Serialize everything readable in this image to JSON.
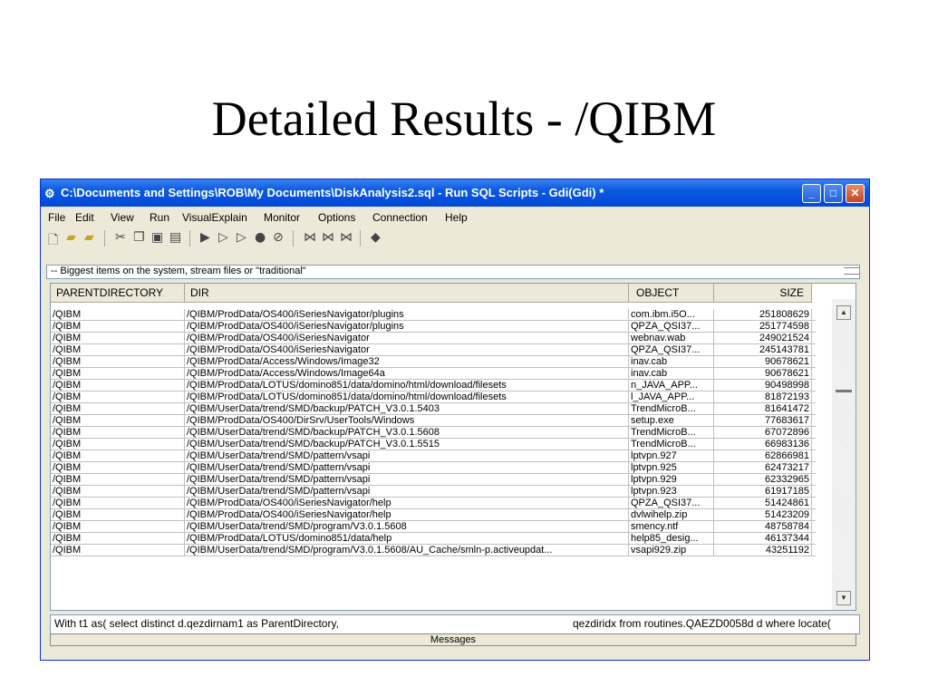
{
  "slide": {
    "title": "Detailed Results - /QIBM"
  },
  "window": {
    "title": "C:\\Documents and Settings\\ROB\\My Documents\\DiskAnalysis2.sql - Run SQL Scripts - Gdi(Gdi) *",
    "minimize_glyph": "_",
    "maximize_glyph": "□",
    "close_glyph": "✕"
  },
  "menu": {
    "file": "File",
    "edit": "Edit",
    "view": "View",
    "run": "Run",
    "visual_explain": "VisualExplain",
    "monitor": "Monitor",
    "options": "Options",
    "connection": "Connection",
    "help": "Help"
  },
  "editor": {
    "line": "-- Biggest items on the system, stream files or \"traditional\""
  },
  "grid": {
    "headers": [
      "PARENTDIRECTORY",
      "DIR",
      "OBJECT",
      "SIZE"
    ],
    "rows": [
      [
        "/QIBM",
        "/QIBM/ProdData/OS400/iSeriesNavigator/plugins",
        "com.ibm.i5O...",
        "251808629"
      ],
      [
        "/QIBM",
        "/QIBM/ProdData/OS400/iSeriesNavigator/plugins",
        "QPZA_QSI37...",
        "251774598"
      ],
      [
        "/QIBM",
        "/QIBM/ProdData/OS400/iSeriesNavigator",
        "webnav.wab",
        "249021524"
      ],
      [
        "/QIBM",
        "/QIBM/ProdData/OS400/iSeriesNavigator",
        "QPZA_QSI37...",
        "245143781"
      ],
      [
        "/QIBM",
        "/QIBM/ProdData/Access/Windows/Image32",
        "inav.cab",
        "90678621"
      ],
      [
        "/QIBM",
        "/QIBM/ProdData/Access/Windows/Image64a",
        "inav.cab",
        "90678621"
      ],
      [
        "/QIBM",
        "/QIBM/ProdData/LOTUS/domino851/data/domino/html/download/filesets",
        "n_JAVA_APP...",
        "90498998"
      ],
      [
        "/QIBM",
        "/QIBM/ProdData/LOTUS/domino851/data/domino/html/download/filesets",
        "l_JAVA_APP...",
        "81872193"
      ],
      [
        "/QIBM",
        "/QIBM/UserData/trend/SMD/backup/PATCH_V3.0.1.5403",
        "TrendMicroB...",
        "81641472"
      ],
      [
        "/QIBM",
        "/QIBM/ProdData/OS400/DirSrv/UserTools/Windows",
        "setup.exe",
        "77683617"
      ],
      [
        "/QIBM",
        "/QIBM/UserData/trend/SMD/backup/PATCH_V3.0.1.5608",
        "TrendMicroB...",
        "67072896"
      ],
      [
        "/QIBM",
        "/QIBM/UserData/trend/SMD/backup/PATCH_V3.0.1.5515",
        "TrendMicroB...",
        "66983136"
      ],
      [
        "/QIBM",
        "/QIBM/UserData/trend/SMD/pattern/vsapi",
        "lptvpn.927",
        "62866981"
      ],
      [
        "/QIBM",
        "/QIBM/UserData/trend/SMD/pattern/vsapi",
        "lptvpn.925",
        "62473217"
      ],
      [
        "/QIBM",
        "/QIBM/UserData/trend/SMD/pattern/vsapi",
        "lptvpn.929",
        "62332965"
      ],
      [
        "/QIBM",
        "/QIBM/UserData/trend/SMD/pattern/vsapi",
        "lptvpn.923",
        "61917185"
      ],
      [
        "/QIBM",
        "/QIBM/ProdData/OS400/iSeriesNavigator/help",
        "QPZA_QSI37...",
        "51424861"
      ],
      [
        "/QIBM",
        "/QIBM/ProdData/OS400/iSeriesNavigator/help",
        "dvlwihelp.zip",
        "51423209"
      ],
      [
        "/QIBM",
        "/QIBM/UserData/trend/SMD/program/V3.0.1.5608",
        "smency.ntf",
        "48758784"
      ],
      [
        "/QIBM",
        "/QIBM/ProdData/LOTUS/domino851/data/help",
        "help85_desig...",
        "46137344"
      ],
      [
        "/QIBM",
        "/QIBM/UserData/trend/SMD/program/V3.0.1.5608/AU_Cache/smln-p.activeupdat...",
        "vsapi929.zip",
        "43251192"
      ]
    ]
  },
  "messages": {
    "left": "With t1 as( select distinct d.qezdirnam1 as ParentDirectory,",
    "right": "qezdiridx from routines.QAEZD0058d d where locate(",
    "tab_label": "Messages"
  },
  "icons": [
    "new-icon",
    "open-icon",
    "save-icon",
    "cut-icon",
    "copy-icon",
    "paste-icon",
    "clipboard-icon",
    "run-all-icon",
    "run-from-icon",
    "run-selected-icon",
    "stop-icon",
    "cancel-icon",
    "explain-icon",
    "explain2-icon",
    "explain3-icon",
    "sql-icon"
  ]
}
